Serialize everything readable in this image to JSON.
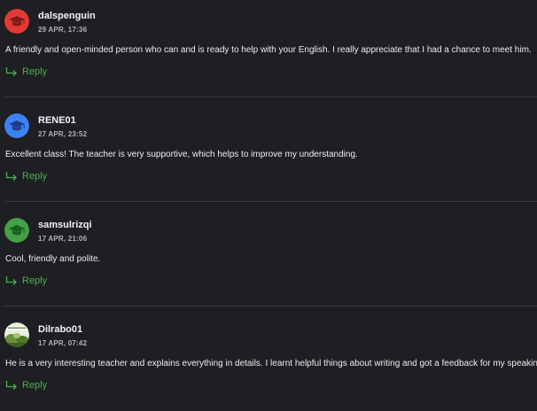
{
  "comments": [
    {
      "username": "dalspenguin",
      "timestamp": "29 APR, 17:36",
      "text": "A friendly and open-minded person who can and is ready to help with your English. I really appreciate that I had a chance to meet him.",
      "reply_label": "Reply",
      "avatar": {
        "type": "default-cap",
        "color": "#e53935",
        "icon": "graduation-cap-icon"
      }
    },
    {
      "username": "RENE01",
      "timestamp": "27 APR, 23:52",
      "text": "Excellent class! The teacher is very supportive, which helps to improve my understanding.",
      "reply_label": "Reply",
      "avatar": {
        "type": "default-cap",
        "color": "#3b82f6",
        "icon": "graduation-cap-icon"
      }
    },
    {
      "username": "samsulrizqi",
      "timestamp": "17 APR, 21:06",
      "text": "Cool, friendly and polite.",
      "reply_label": "Reply",
      "avatar": {
        "type": "default-cap",
        "color": "#43a047",
        "icon": "graduation-cap-icon"
      }
    },
    {
      "username": "Dilrabo01",
      "timestamp": "17 APR, 07:42",
      "text": "He is a very interesting teacher and explains everything in details. I learnt helpful things about writing and got a feedback for my speaking",
      "reply_label": "Reply",
      "avatar": {
        "type": "photo",
        "color": "#6b8f3a",
        "icon": "user-photo"
      }
    }
  ],
  "colors": {
    "background": "#1e1f22",
    "accent_green": "#4caf50",
    "divider": "#3a3b40"
  }
}
